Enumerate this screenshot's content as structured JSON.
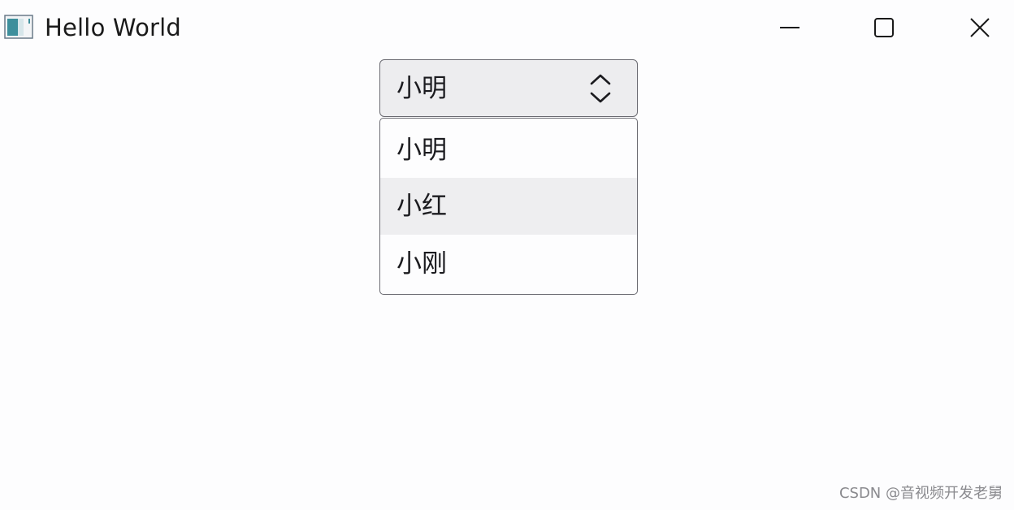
{
  "window": {
    "title": "Hello World",
    "icon": "app-window-icon",
    "controls": {
      "minimize_icon": "minimize-icon",
      "maximize_icon": "maximize-icon",
      "close_icon": "close-icon"
    }
  },
  "combo": {
    "selected": "小明",
    "icon": "chevron-up-down-icon",
    "options": [
      "小明",
      "小红",
      "小刚"
    ],
    "hovered_index": 1
  },
  "watermark": "CSDN @音视频开发老舅",
  "colors": {
    "background": "#fdfdfe",
    "combo_fill": "#ededef",
    "border": "#6b6b72",
    "hover": "#eeeef0",
    "text": "#1b1b1f"
  }
}
